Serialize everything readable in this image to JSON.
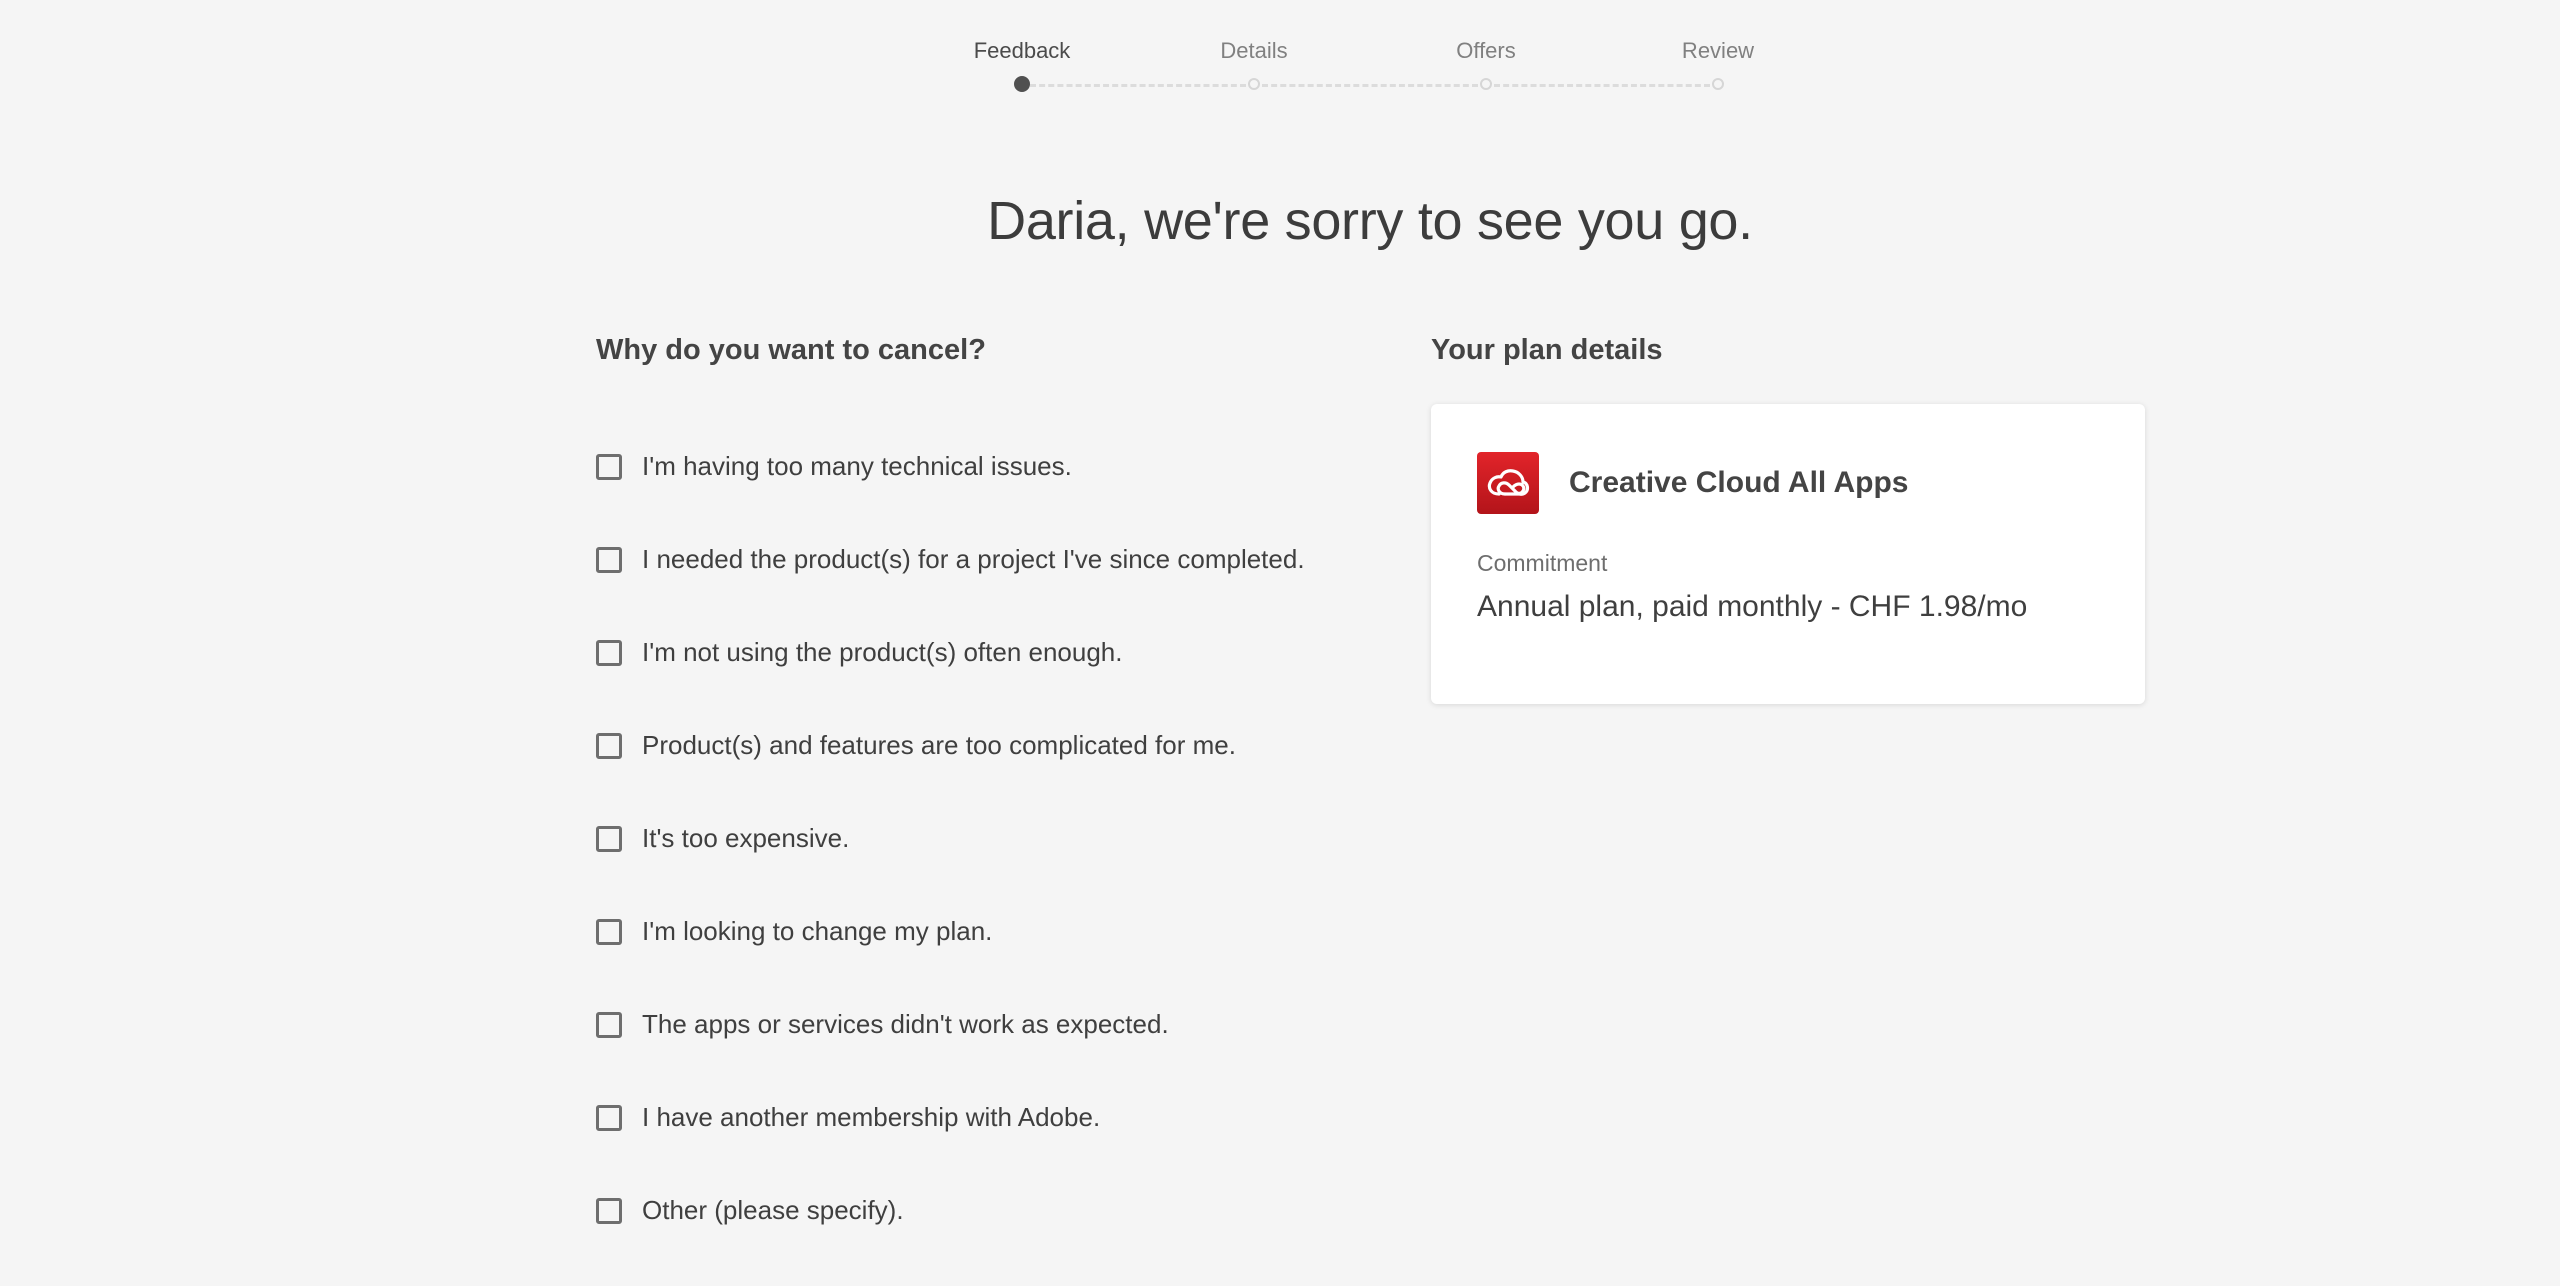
{
  "stepper": {
    "steps": [
      {
        "label": "Feedback",
        "state": "active"
      },
      {
        "label": "Details",
        "state": "upcoming"
      },
      {
        "label": "Offers",
        "state": "upcoming"
      },
      {
        "label": "Review",
        "state": "upcoming"
      }
    ]
  },
  "headline": "Daria, we're sorry to see you go.",
  "cancel": {
    "title": "Why do you want to cancel?",
    "reasons": [
      {
        "label": "I'm having too many technical issues.",
        "checked": false
      },
      {
        "label": "I needed the product(s) for a project I've since completed.",
        "checked": false
      },
      {
        "label": "I'm not using the product(s) often enough.",
        "checked": false
      },
      {
        "label": "Product(s) and features are too complicated for me.",
        "checked": false
      },
      {
        "label": "It's too expensive.",
        "checked": false
      },
      {
        "label": "I'm looking to change my plan.",
        "checked": false
      },
      {
        "label": "The apps or services didn't work as expected.",
        "checked": false
      },
      {
        "label": "I have another membership with Adobe.",
        "checked": false
      },
      {
        "label": "Other (please specify).",
        "checked": false
      }
    ]
  },
  "plan": {
    "title": "Your plan details",
    "product_name": "Creative Cloud All Apps",
    "product_icon": "creative-cloud-icon",
    "commitment_label": "Commitment",
    "commitment_value": "Annual plan, paid monthly - CHF 1.98/mo"
  },
  "colors": {
    "background": "#f5f5f5",
    "brand_red": "#da1f26",
    "active_dot": "#505050",
    "inactive_dot": "#d6d6d6"
  }
}
